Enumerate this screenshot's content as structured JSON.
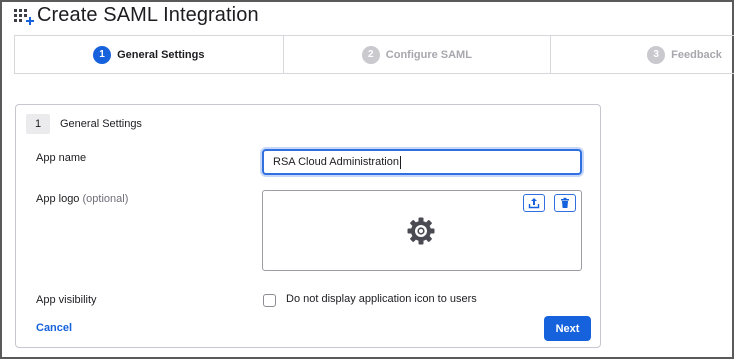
{
  "page": {
    "title": "Create SAML Integration",
    "title_icon": "apps-add-icon"
  },
  "stepper": {
    "steps": [
      {
        "number": "1",
        "label": "General Settings",
        "state": "active"
      },
      {
        "number": "2",
        "label": "Configure SAML",
        "state": "inactive"
      },
      {
        "number": "3",
        "label": "Feedback",
        "state": "inactive"
      }
    ]
  },
  "section": {
    "number": "1",
    "title": "General Settings"
  },
  "form": {
    "app_name": {
      "label": "App name",
      "value": "RSA Cloud Administration"
    },
    "app_logo": {
      "label": "App logo",
      "optional_label": "(optional)",
      "placeholder_icon": "gear-icon"
    },
    "app_visibility": {
      "label": "App visibility",
      "checkbox_label": "Do not display application icon to users",
      "checked": false
    }
  },
  "actions": {
    "cancel_label": "Cancel",
    "next_label": "Next"
  },
  "colors": {
    "accent": "#1662dd",
    "inactive_step": "#c9c9ce"
  }
}
